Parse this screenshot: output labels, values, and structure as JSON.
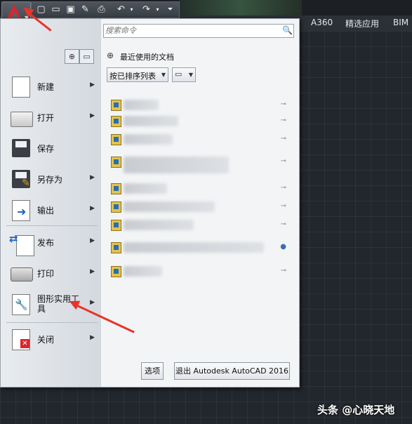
{
  "ribbon_tabs": [
    {
      "label": "A360"
    },
    {
      "label": "精选应用"
    },
    {
      "label": "BIM"
    }
  ],
  "search": {
    "placeholder": "搜索命令"
  },
  "left_menu": {
    "items": [
      {
        "label": "新建",
        "icon": "new-doc-icon",
        "has_submenu": true
      },
      {
        "label": "打开",
        "icon": "folder-open-icon",
        "has_submenu": true
      },
      {
        "label": "保存",
        "icon": "save-disk-icon",
        "has_submenu": false
      },
      {
        "label": "另存为",
        "icon": "save-as-icon",
        "has_submenu": true
      },
      {
        "label": "输出",
        "icon": "export-icon",
        "has_submenu": true
      },
      {
        "label": "发布",
        "icon": "publish-icon",
        "has_submenu": true
      },
      {
        "label": "打印",
        "icon": "printer-icon",
        "has_submenu": true
      },
      {
        "label": "图形实用工具",
        "icon": "wrench-icon",
        "has_submenu": true
      },
      {
        "label": "关闭",
        "icon": "close-doc-icon",
        "has_submenu": true
      }
    ]
  },
  "recent": {
    "title": "最近使用的文档",
    "sort_label": "按已排序列表",
    "documents_count_visible": 10
  },
  "footer": {
    "options_label": "选项",
    "exit_label": "退出 Autodesk AutoCAD 2016"
  },
  "watermark": {
    "text": "头条 @心晓天地"
  },
  "colors": {
    "accent_red": "#d6282d",
    "arrow_red": "#e8342a",
    "menu_bg": "#d9dde2"
  }
}
